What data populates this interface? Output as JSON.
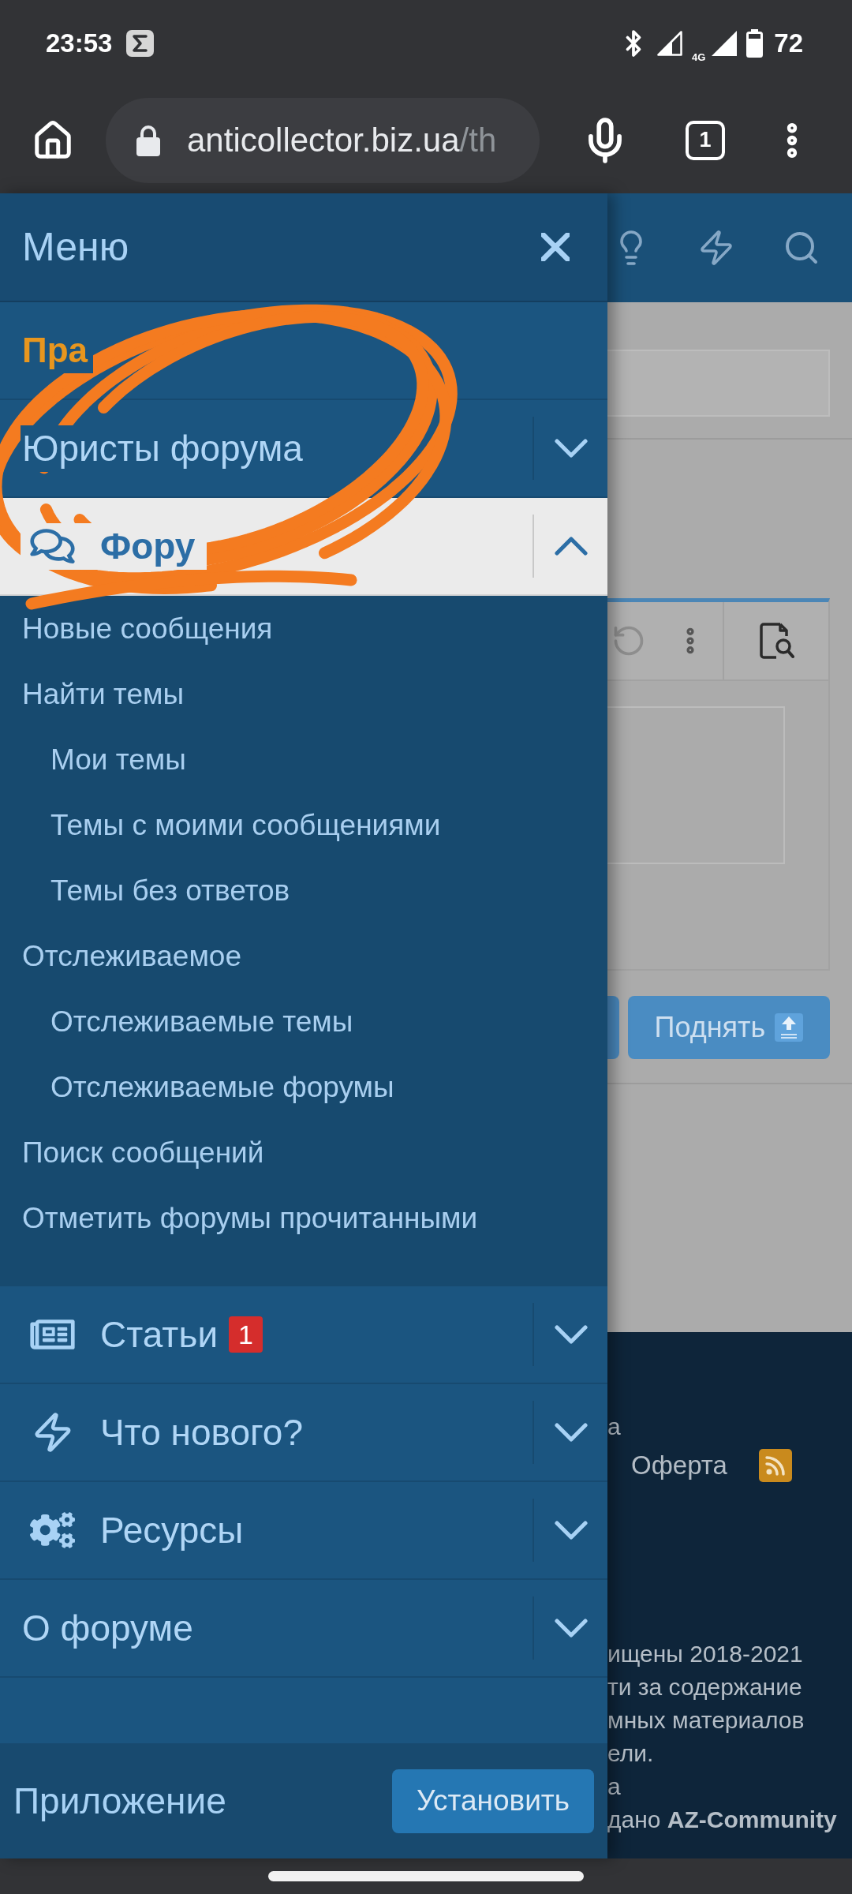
{
  "status_bar": {
    "time": "23:53",
    "network": "4G",
    "battery": "72"
  },
  "browser": {
    "url": "anticollector.biz.ua",
    "url_faded": "/th",
    "tab_count": "1"
  },
  "menu": {
    "title": "Меню",
    "items": [
      {
        "kind": "link",
        "label": "Пра",
        "selected": false
      },
      {
        "kind": "group",
        "label": "Юристы форума",
        "selected": false,
        "expanded": false
      },
      {
        "kind": "group",
        "label": "Фору",
        "selected": true,
        "expanded": true,
        "children": [
          {
            "label": "Новые сообщения"
          },
          {
            "label": "Найти темы",
            "children": [
              {
                "label": "Мои темы"
              },
              {
                "label": "Темы с моими сообщениями"
              },
              {
                "label": "Темы без ответов"
              }
            ]
          },
          {
            "label": "Отслеживаемое",
            "children": [
              {
                "label": "Отслеживаемые темы"
              },
              {
                "label": "Отслеживаемые форумы"
              }
            ]
          },
          {
            "label": "Поиск сообщений"
          },
          {
            "label": "Отметить форумы прочитанными"
          }
        ]
      },
      {
        "kind": "group",
        "label": "Статьи",
        "badge": "1",
        "selected": false,
        "expanded": false
      },
      {
        "kind": "group",
        "label": "Что нового?",
        "selected": false,
        "expanded": false
      },
      {
        "kind": "group",
        "label": "Ресурсы",
        "selected": false,
        "expanded": false
      },
      {
        "kind": "group",
        "label": "О форуме",
        "selected": false,
        "expanded": false
      }
    ]
  },
  "app_bar": {
    "label": "Приложение",
    "button": "Установить"
  },
  "page": {
    "bump_button": "Поднять",
    "footer": {
      "fragment": "а",
      "link": "Оферта",
      "legal": [
        "ищены 2018-2021",
        "ти за содержание",
        "мных материалов",
        "ели.",
        "а",
        "дано **AZ-Community**"
      ]
    }
  },
  "annotation": {
    "kind": "scribble"
  }
}
